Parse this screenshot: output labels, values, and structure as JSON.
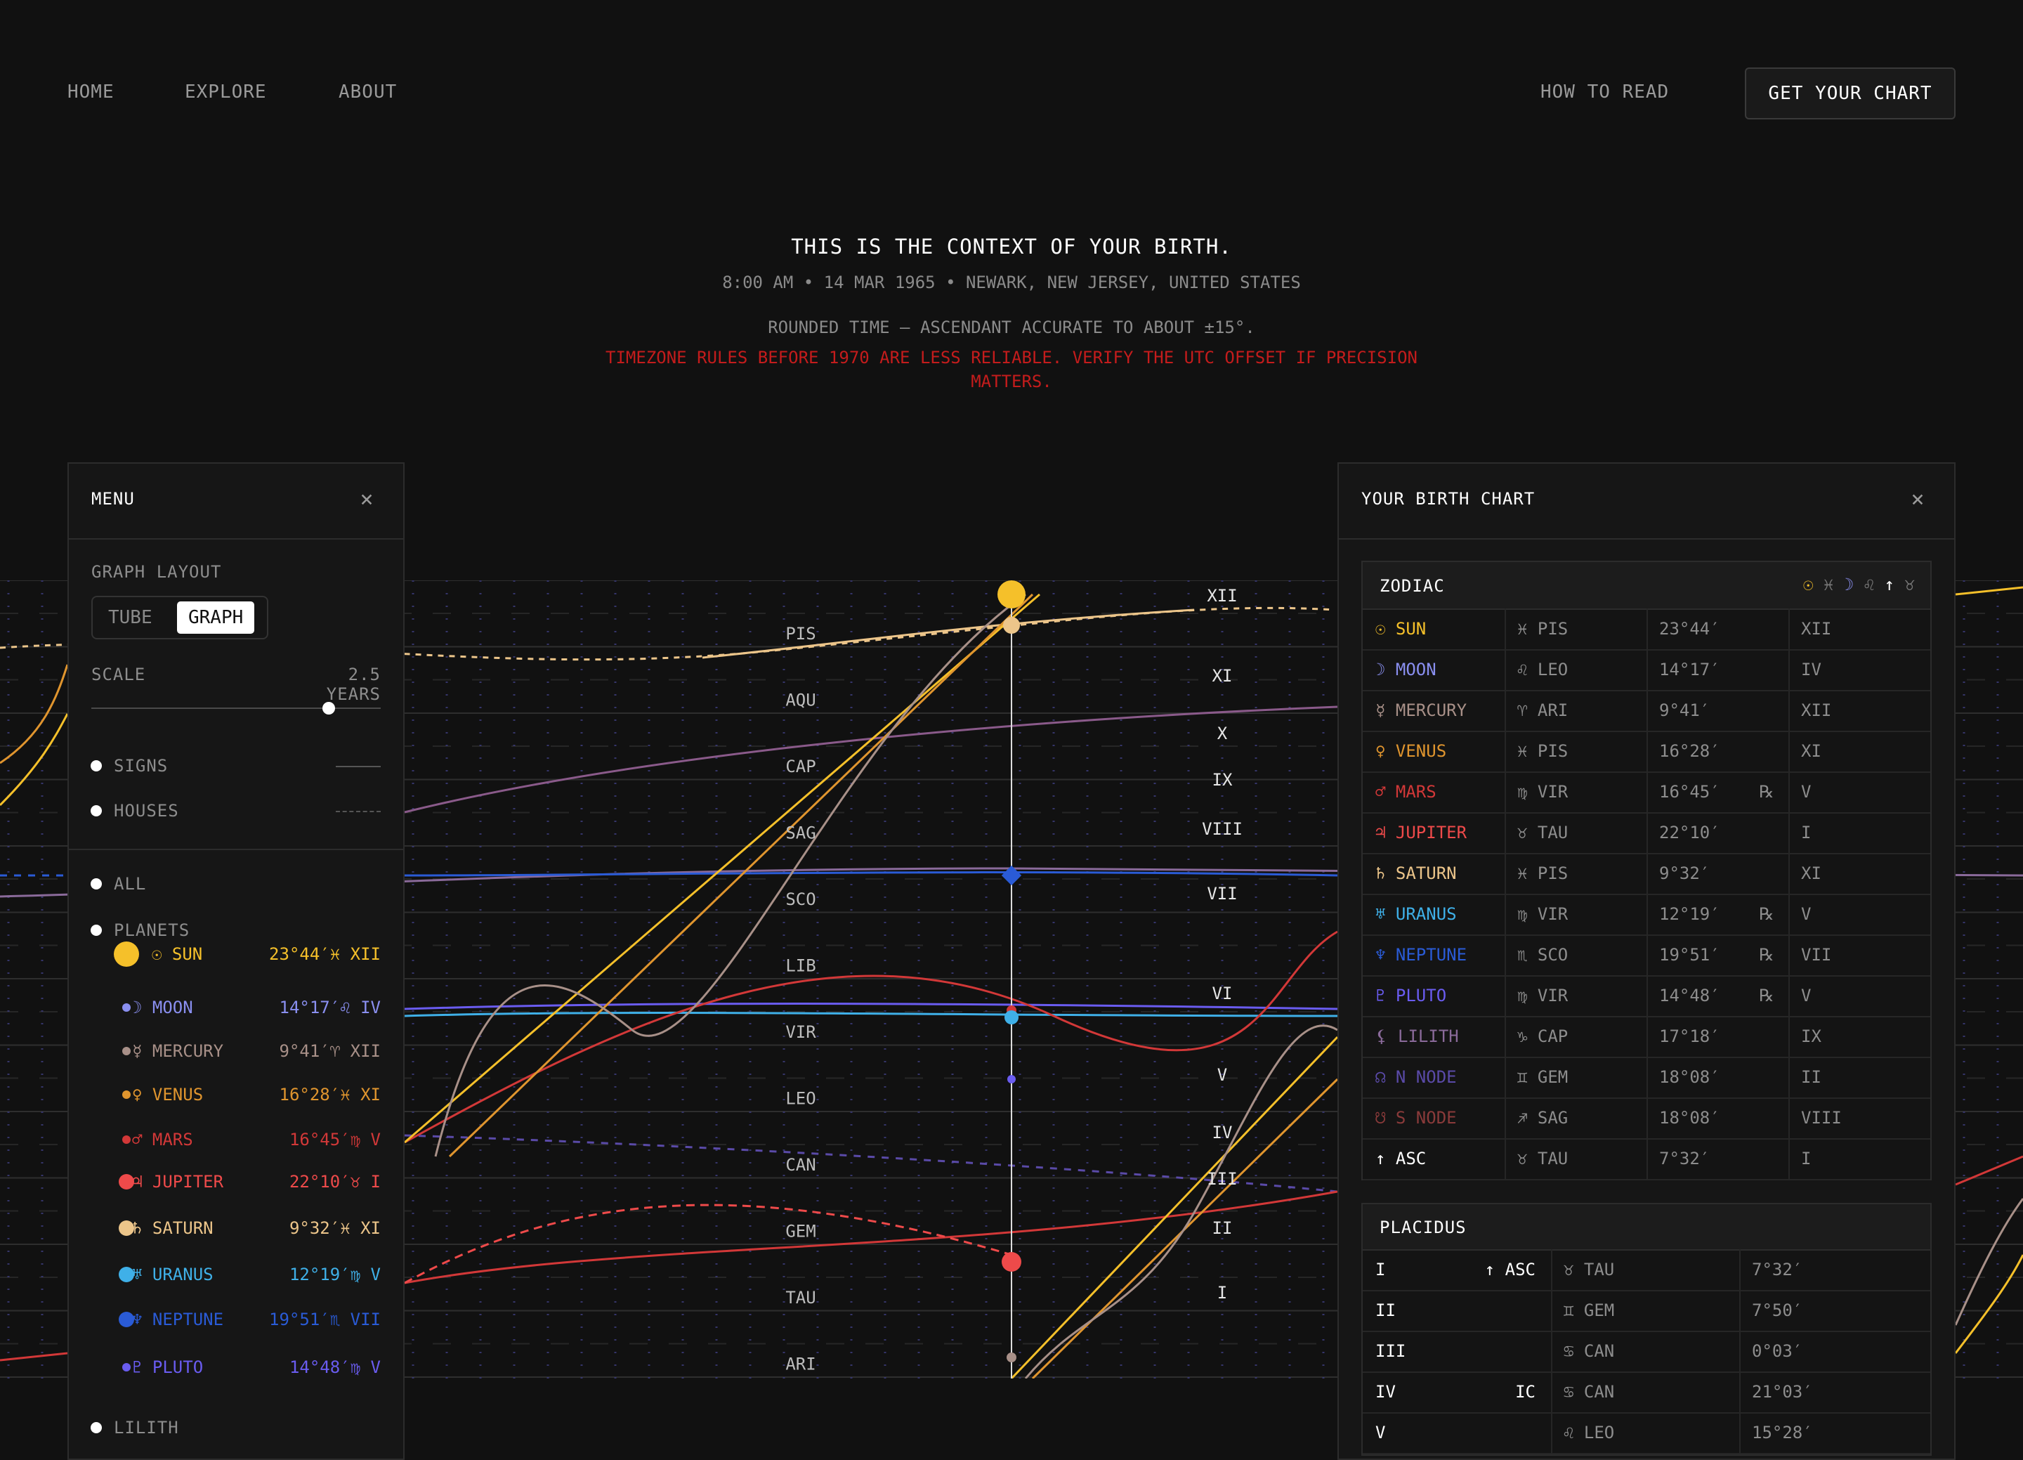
{
  "nav": {
    "home": "HOME",
    "explore": "EXPLORE",
    "about": "ABOUT",
    "how_to_read": "HOW TO READ",
    "cta": "GET YOUR CHART"
  },
  "hero": {
    "title": "THIS IS THE CONTEXT OF YOUR BIRTH.",
    "subtitle": "8:00 AM • 14 MAR 1965 • NEWARK, NEW JERSEY, UNITED STATES",
    "note": "ROUNDED TIME — ASCENDANT ACCURATE TO ABOUT ±15°.",
    "warning": "TIMEZONE RULES BEFORE 1970 ARE LESS RELIABLE. VERIFY THE UTC OFFSET IF PRECISION MATTERS."
  },
  "menu": {
    "title": "MENU",
    "close_icon": "close-icon",
    "graph_layout_label": "GRAPH LAYOUT",
    "layout_options": [
      "TUBE",
      "GRAPH"
    ],
    "layout_selected": "GRAPH",
    "scale_label": "SCALE",
    "scale_value": "2.5 YEARS",
    "scale_fraction": 0.82,
    "signs_label": "SIGNS",
    "houses_label": "HOUSES",
    "all_label": "ALL",
    "planets_label": "PLANETS",
    "lilith_label": "LILITH",
    "planets": [
      {
        "name": "☉ SUN",
        "value": "23°44′♓ XII",
        "color": "#f5c02a",
        "big": true
      },
      {
        "name": "☽ MOON",
        "value": "14°17′♌ IV",
        "color": "#8a8ff0",
        "big": false
      },
      {
        "name": "☿ MERCURY",
        "value": "9°41′♈ XII",
        "color": "#a89088",
        "big": false
      },
      {
        "name": "♀ VENUS",
        "value": "16°28′♓ XI",
        "color": "#e0952e",
        "big": false
      },
      {
        "name": "♂ MARS",
        "value": "16°45′♍ V",
        "color": "#d23838",
        "big": false
      },
      {
        "name": "♃ JUPITER",
        "value": "22°10′♉ I",
        "color": "#ee4a4a",
        "big": true
      },
      {
        "name": "♄ SATURN",
        "value": "9°32′♓ XI",
        "color": "#ecc58a",
        "big": true
      },
      {
        "name": "♅ URANUS",
        "value": "12°19′♍ V",
        "color": "#3fb0e8",
        "big": true
      },
      {
        "name": "♆ NEPTUNE",
        "value": "19°51′♏ VII",
        "color": "#2a5bd6",
        "big": true
      },
      {
        "name": "♇ PLUTO",
        "value": "14°48′♍ V",
        "color": "#6a5cf0",
        "big": false
      }
    ]
  },
  "chart_panel": {
    "title": "YOUR BIRTH CHART",
    "zodiac_title": "ZODIAC",
    "zodiac_summary_glyphs": [
      "☉",
      "♓",
      "☽",
      "♌",
      "↑",
      "♉"
    ],
    "zodiac_rows": [
      {
        "body": "☉ SUN",
        "sign": "♓ PIS",
        "deg": "23°44′",
        "retro": "",
        "house": "XII",
        "color": "#f5c02a"
      },
      {
        "body": "☽ MOON",
        "sign": "♌ LEO",
        "deg": "14°17′",
        "retro": "",
        "house": "IV",
        "color": "#8a8ff0"
      },
      {
        "body": "☿ MERCURY",
        "sign": "♈ ARI",
        "deg": "9°41′",
        "retro": "",
        "house": "XII",
        "color": "#a89088"
      },
      {
        "body": "♀ VENUS",
        "sign": "♓ PIS",
        "deg": "16°28′",
        "retro": "",
        "house": "XI",
        "color": "#e0952e"
      },
      {
        "body": "♂ MARS",
        "sign": "♍ VIR",
        "deg": "16°45′",
        "retro": "℞",
        "house": "V",
        "color": "#d23838"
      },
      {
        "body": "♃ JUPITER",
        "sign": "♉ TAU",
        "deg": "22°10′",
        "retro": "",
        "house": "I",
        "color": "#ee4a4a"
      },
      {
        "body": "♄ SATURN",
        "sign": "♓ PIS",
        "deg": "9°32′",
        "retro": "",
        "house": "XI",
        "color": "#ecc58a"
      },
      {
        "body": "♅ URANUS",
        "sign": "♍ VIR",
        "deg": "12°19′",
        "retro": "℞",
        "house": "V",
        "color": "#3fb0e8"
      },
      {
        "body": "♆ NEPTUNE",
        "sign": "♏ SCO",
        "deg": "19°51′",
        "retro": "℞",
        "house": "VII",
        "color": "#2a5bd6"
      },
      {
        "body": "♇ PLUTO",
        "sign": "♍ VIR",
        "deg": "14°48′",
        "retro": "℞",
        "house": "V",
        "color": "#6a5cf0"
      },
      {
        "body": "⚸ LILITH",
        "sign": "♑ CAP",
        "deg": "17°18′",
        "retro": "",
        "house": "IX",
        "color": "#8a6a9a"
      },
      {
        "body": "☊ N NODE",
        "sign": "♊ GEM",
        "deg": "18°08′",
        "retro": "",
        "house": "II",
        "color": "#5a4aa8"
      },
      {
        "body": "☋ S NODE",
        "sign": "♐ SAG",
        "deg": "18°08′",
        "retro": "",
        "house": "VIII",
        "color": "#8a3a3a"
      },
      {
        "body": "↑ ASC",
        "sign": "♉ TAU",
        "deg": "7°32′",
        "retro": "",
        "house": "I",
        "color": "#ffffff"
      }
    ],
    "placidus_title": "PLACIDUS",
    "placidus_rows": [
      {
        "house": "I",
        "tag": "↑ ASC",
        "sign": "♉ TAU",
        "deg": "7°32′"
      },
      {
        "house": "II",
        "tag": "",
        "sign": "♊ GEM",
        "deg": "7°50′"
      },
      {
        "house": "III",
        "tag": "",
        "sign": "♋ CAN",
        "deg": "0°03′"
      },
      {
        "house": "IV",
        "tag": "IC",
        "sign": "♋ CAN",
        "deg": "21°03′"
      },
      {
        "house": "V",
        "tag": "",
        "sign": "♌ LEO",
        "deg": "15°28′"
      }
    ]
  },
  "graph": {
    "sign_labels": [
      "PIS",
      "AQU",
      "CAP",
      "SAG",
      "SCO",
      "LIB",
      "VIR",
      "LEO",
      "CAN",
      "GEM",
      "TAU",
      "ARI"
    ],
    "house_labels": [
      "XII",
      "XI",
      "X",
      "IX",
      "VIII",
      "VII",
      "VI",
      "V",
      "IV",
      "III",
      "II",
      "I"
    ]
  }
}
